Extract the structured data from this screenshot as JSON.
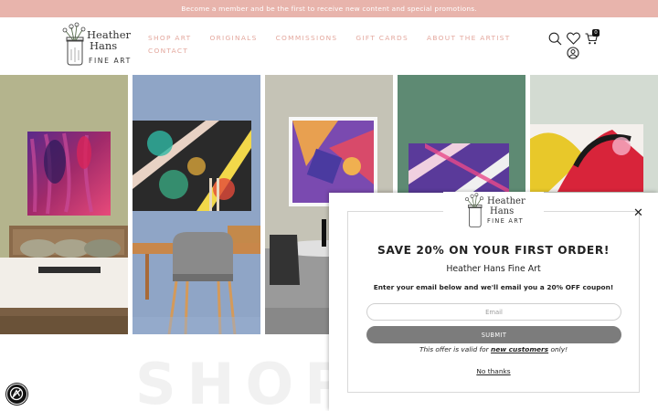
{
  "announcement": "Become a member and be the first to receive new content and special promotions.",
  "logo": {
    "line1": "Heather",
    "line2": "Hans",
    "subtitle": "FINE ART"
  },
  "nav": {
    "items": [
      "SHOP ART",
      "ORIGINALS",
      "COMMISSIONS",
      "GIFT CARDS",
      "ABOUT THE ARTIST"
    ],
    "items_row2": [
      "CONTACT"
    ]
  },
  "header_icons": {
    "search": "search-icon",
    "wishlist": "heart-icon",
    "cart": "cart-icon",
    "account": "account-icon",
    "cart_count": "0"
  },
  "colors": {
    "accent": "#e8b4ac",
    "nav_text": "#e4a89e",
    "submit": "#7c7c7c"
  },
  "hero": {
    "watermark": "SHOP"
  },
  "popup": {
    "logo_line1": "Heather",
    "logo_line2": "Hans",
    "logo_sub": "FINE ART",
    "headline": "SAVE 20% ON YOUR FIRST ORDER!",
    "brand": "Heather Hans Fine Art",
    "instructions": "Enter your email below and we'll email you a 20% OFF coupon!",
    "email_placeholder": "Email",
    "submit_label": "SUBMIT",
    "offer_pre": "This offer is valid for ",
    "offer_link": "new customers",
    "offer_post": " only!",
    "no_thanks": "No thanks",
    "close_icon": "close-icon"
  },
  "accessibility_icon": "accessibility-icon"
}
